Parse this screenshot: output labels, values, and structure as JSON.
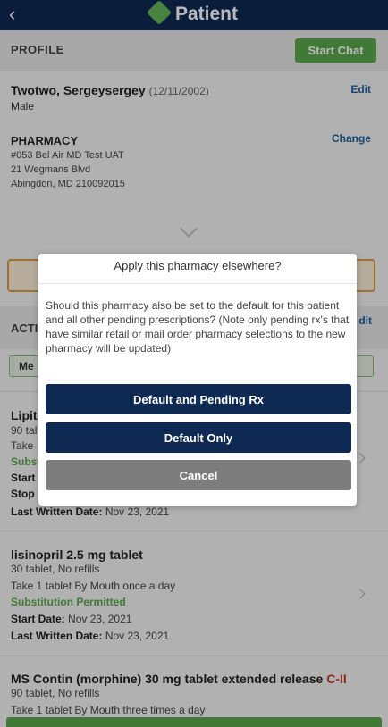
{
  "app": {
    "title": "Patient",
    "back_label": "‹"
  },
  "profile": {
    "section_label": "PROFILE",
    "start_chat_label": "Start Chat",
    "patient_name": "Twotwo, Sergeysergey",
    "dob": "(12/11/2002)",
    "sex": "Male",
    "edit_label": "Edit"
  },
  "pharmacy": {
    "title": "PHARMACY",
    "change_label": "Change",
    "lines": [
      "#053 Bel Air MD Test UAT",
      "21 Wegmans Blvd",
      "Abingdon, MD 210092015"
    ]
  },
  "active": {
    "section_label_partial": "ACTI",
    "edit_partial": "dit",
    "chip_partial": "Me"
  },
  "rx_list": [
    {
      "name": "Lipit",
      "lines": [
        "90 tal",
        "Take"
      ],
      "sub": "Subst",
      "start": "Start",
      "stop": "Stop",
      "last_written_label": "Last Written Date:",
      "last_written": "Nov 23, 2021"
    },
    {
      "name": "lisinopril 2.5 mg tablet",
      "qty": "30 tablet, No refills",
      "sig": "Take 1 tablet By Mouth once a day",
      "sub": "Substitution Permitted",
      "start_label": "Start Date:",
      "start": "Nov 23, 2021",
      "last_written_label": "Last Written Date:",
      "last_written": "Nov 23, 2021"
    },
    {
      "name": "MS Contin (morphine) 30 mg tablet extended release",
      "schedule": "C-II",
      "qty": "90 tablet, No refills",
      "sig": "Take 1 tablet By Mouth three times a day"
    }
  ],
  "modal": {
    "title": "Apply this pharmacy elsewhere?",
    "body": "Should this pharmacy also be set to the default for this patient and all other pending prescriptions? (Note only pending rx's that have similar retail or mail order pharmacy selections to the new pharmacy will be updated)",
    "btn_default_pending": "Default and Pending Rx",
    "btn_default_only": "Default Only",
    "btn_cancel": "Cancel"
  },
  "colors": {
    "navy": "#0f2a52",
    "green": "#5aa64a",
    "link": "#1d5f9a",
    "schedule": "#c0392b"
  }
}
